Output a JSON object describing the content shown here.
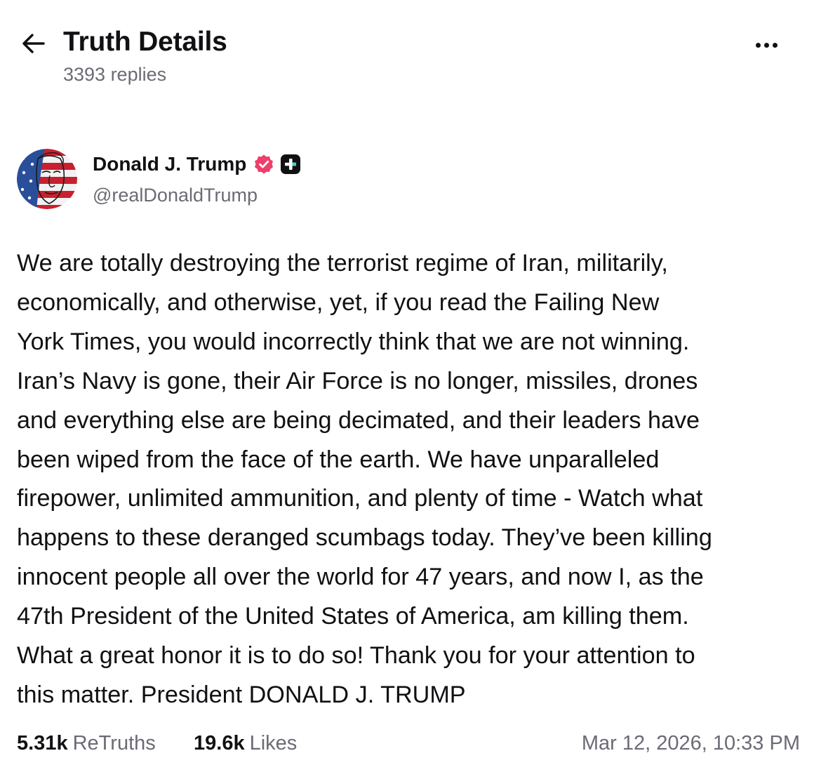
{
  "header": {
    "back_icon": "arrow-left-icon",
    "title": "Truth Details",
    "replies": "3393 replies",
    "more_icon": "more-horizontal-icon"
  },
  "author": {
    "name": "Donald J. Trump",
    "handle": "@realDonaldTrump",
    "verified_icon": "verified-badge-icon",
    "verified_color": "#f03e6b",
    "plus_icon": "plus-badge-icon"
  },
  "post": {
    "lines": [
      "We are totally destroying the terrorist regime of Iran, militarily,",
      "economically, and otherwise, yet, if you read the Failing New",
      "York Times, you would incorrectly think that we are not winning.",
      "Iran’s Navy is gone, their Air Force is no longer, missiles, drones",
      "and everything else are being decimated, and their leaders have",
      "been wiped from the face of the earth. We have unparalleled",
      "firepower, unlimited ammunition, and plenty of time - Watch what",
      "happens to these deranged scumbags today. They’ve been killing",
      "innocent people all over the world for 47 years, and now I, as the",
      "47th President of the United States of America, am killing them.",
      "What a great honor it is to do so! Thank you for your attention to",
      "this matter. President DONALD J. TRUMP"
    ]
  },
  "stats": {
    "retruths_count": "5.31k",
    "retruths_label": "ReTruths",
    "likes_count": "19.6k",
    "likes_label": "Likes",
    "timestamp": "Mar 12, 2026, 10:33 PM"
  }
}
